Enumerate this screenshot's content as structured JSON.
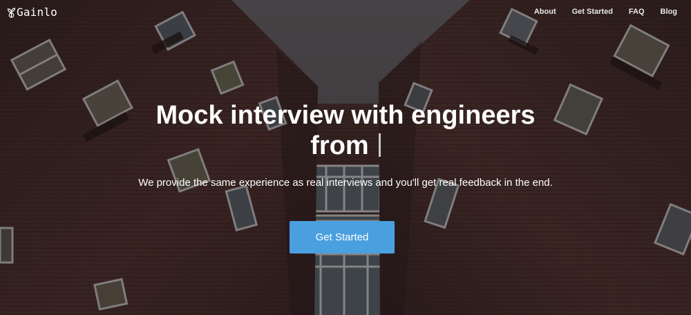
{
  "brand": {
    "name": "Gainlo",
    "icon": "sprout-icon"
  },
  "nav": {
    "links": [
      "About",
      "Get Started",
      "FAQ",
      "Blog"
    ]
  },
  "hero": {
    "title_line1": "Mock interview with engineers",
    "title_line2": "from",
    "subtitle": "We provide the same experience as real interviews and you'll get real feedback in the end.",
    "cta_label": "Get Started"
  },
  "colors": {
    "cta": "#4a9fdf",
    "text": "#ffffff",
    "sky": "#6b6a6d",
    "brick": "#5a3a34"
  }
}
